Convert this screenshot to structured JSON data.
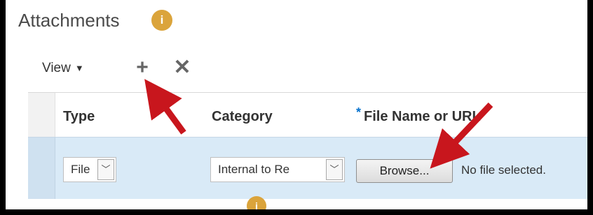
{
  "header": {
    "title": "Attachments",
    "info_icon_glyph": "i"
  },
  "toolbar": {
    "view_label": "View",
    "view_caret": "▼",
    "add_glyph": "+",
    "delete_glyph": "✕"
  },
  "table": {
    "columns": {
      "type": "Type",
      "category": "Category",
      "file_name_required": "*",
      "file_name": "File Name or URL"
    },
    "rows": [
      {
        "type": "File",
        "category": "Internal to Re",
        "browse_label": "Browse...",
        "file_status": "No file selected."
      }
    ]
  },
  "footer": {
    "info_icon_glyph": "i"
  },
  "colors": {
    "accent": "#dba43b",
    "selected_row": "#d9eaf7",
    "arrow": "#c8161d",
    "required": "#0572ce"
  }
}
